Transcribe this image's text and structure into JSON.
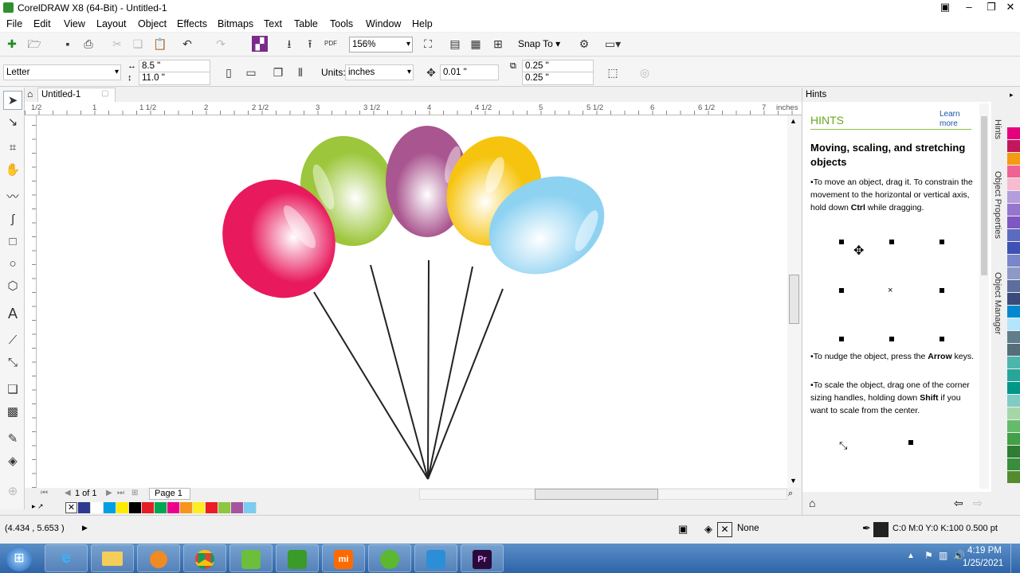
{
  "window": {
    "title": "CorelDRAW X8 (64-Bit) - Untitled-1"
  },
  "menu": [
    "File",
    "Edit",
    "View",
    "Layout",
    "Object",
    "Effects",
    "Bitmaps",
    "Text",
    "Table",
    "Tools",
    "Window",
    "Help"
  ],
  "standard": {
    "zoom": "156%",
    "snap_label": "Snap To",
    "pdf": "PDF"
  },
  "props": {
    "paper": "Letter",
    "width": "8.5 \"",
    "height": "11.0 \"",
    "units_label": "Units:",
    "units": "inches",
    "nudge": "0.01 \"",
    "dup_x": "0.25 \"",
    "dup_y": "0.25 \""
  },
  "doc": {
    "tab": "Untitled-1",
    "ruler_unit": "inches",
    "ruler_labels": [
      "1/2",
      "1",
      "1 1/2",
      "2",
      "2 1/2",
      "3",
      "3 1/2",
      "4",
      "4 1/2",
      "5",
      "5 1/2",
      "6",
      "6 1/2",
      "7"
    ]
  },
  "balloons": [
    {
      "color": "#e8195d"
    },
    {
      "color": "#9cc63b"
    },
    {
      "color": "#a9558f"
    },
    {
      "color": "#f6c40e"
    },
    {
      "color": "#8ed2f2"
    }
  ],
  "pagenav": {
    "page_of": "1 of 1",
    "page_name": "Page 1"
  },
  "palette": [
    "#2d3990",
    "#ffffff",
    "#00a0e3",
    "#ffeb00",
    "#000000",
    "#e31e24",
    "#00a651",
    "#ec008c",
    "#f7941d",
    "#fcee21",
    "#ed1c24",
    "#8dc63f",
    "#a6559d",
    "#7accf0"
  ],
  "right_palette": [
    "#e6007e",
    "#c2185b",
    "#f39c12",
    "#f06292",
    "#f8bbd0",
    "#b39ddb",
    "#9575cd",
    "#7e57c2",
    "#5c6bc0",
    "#3f51b5",
    "#7986cb",
    "#8e99c7",
    "#5d6d9e",
    "#3a4a7a",
    "#0288d1",
    "#b3e5fc",
    "#607d8b",
    "#546e7a",
    "#4db6ac",
    "#26a69a",
    "#009688",
    "#80cbc4",
    "#a5d6a7",
    "#66bb6a",
    "#43a047",
    "#2e7d32",
    "#388e3c",
    "#558b2f"
  ],
  "hints": {
    "panel_title": "Hints",
    "heading": "HINTS",
    "learn_more": "Learn more",
    "section_title": "Moving, scaling, and stretching objects",
    "p1a": "To move an object, drag it. To constrain the movement to the horizontal or vertical axis, hold down ",
    "p1b": "Ctrl",
    "p1c": " while dragging.",
    "p2a": "To nudge the object, press the ",
    "p2b": "Arrow",
    "p2c": " keys.",
    "p3a": "To scale the object, drag one of the corner sizing handles, holding down ",
    "p3b": "Shift",
    "p3c": " if you want to scale from the center."
  },
  "dock_tabs": [
    "Hints",
    "Object Properties",
    "Object Manager"
  ],
  "status": {
    "coords": "(4.434 , 5.653 )",
    "fill": "None",
    "outline": "C:0 M:0 Y:0 K:100  0.500 pt"
  },
  "clock": {
    "time": "4:19 PM",
    "date": "1/25/2021"
  },
  "taskbar_apps": [
    "start-orb",
    "internet-explorer",
    "file-explorer",
    "media-player",
    "chrome",
    "app-green",
    "app-green-2",
    "mi-app",
    "app-green-3",
    "network-app",
    "premiere"
  ]
}
